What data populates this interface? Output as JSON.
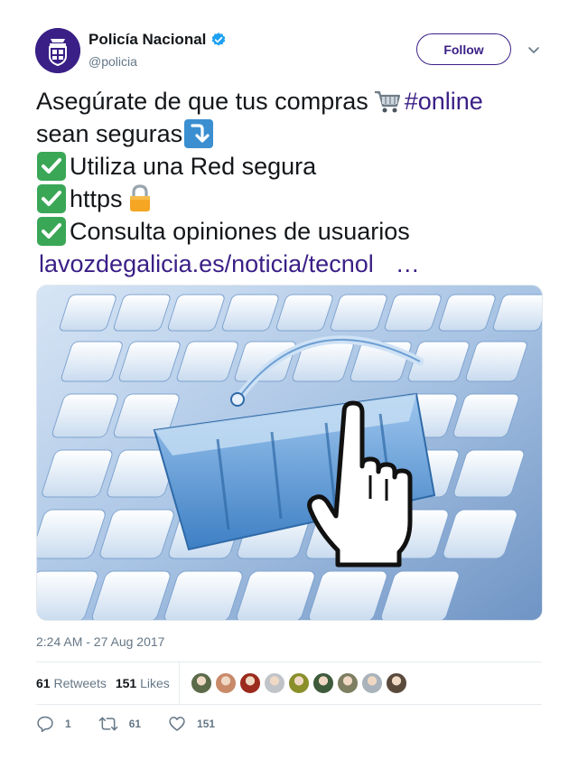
{
  "author": {
    "display_name": "Policía Nacional",
    "handle": "@policia",
    "verified": true,
    "avatar_color": "#3a1f86"
  },
  "follow_label": "Follow",
  "tweet": {
    "line1_text": "Asegúrate de que tus compras",
    "line1_emoji": "shopping-cart-icon",
    "hashtag": "#online",
    "line2_text": "sean seguras",
    "line2_emoji": "arrow-down-icon",
    "line3_text": "Utiliza una Red segura",
    "line4_text": "https",
    "line4_emoji": "lock-icon",
    "line5_text": "Consulta opiniones de usuarios",
    "link_text": "lavozdegalicia.es/noticia/tecnol",
    "link_ellipsis": "…"
  },
  "media": {
    "description_icon": "shopping-basket-keyboard-image"
  },
  "timestamp": "2:24 AM - 27 Aug 2017",
  "stats": {
    "retweets_count": "61",
    "retweets_label": "Retweets",
    "likes_count": "151",
    "likes_label": "Likes"
  },
  "likers": [
    "#5b6b4a",
    "#c98a6a",
    "#9b2b1e",
    "#c0c4c8",
    "#8a8f2a",
    "#3d5b3b",
    "#7e7f62",
    "#aab3bb",
    "#5a4a3c"
  ],
  "actions": {
    "reply_count": "1",
    "retweet_count": "61",
    "like_count": "151"
  },
  "colors": {
    "brand": "#3a1f86",
    "verified": "#1da1f2",
    "check_green": "#3aa757"
  }
}
